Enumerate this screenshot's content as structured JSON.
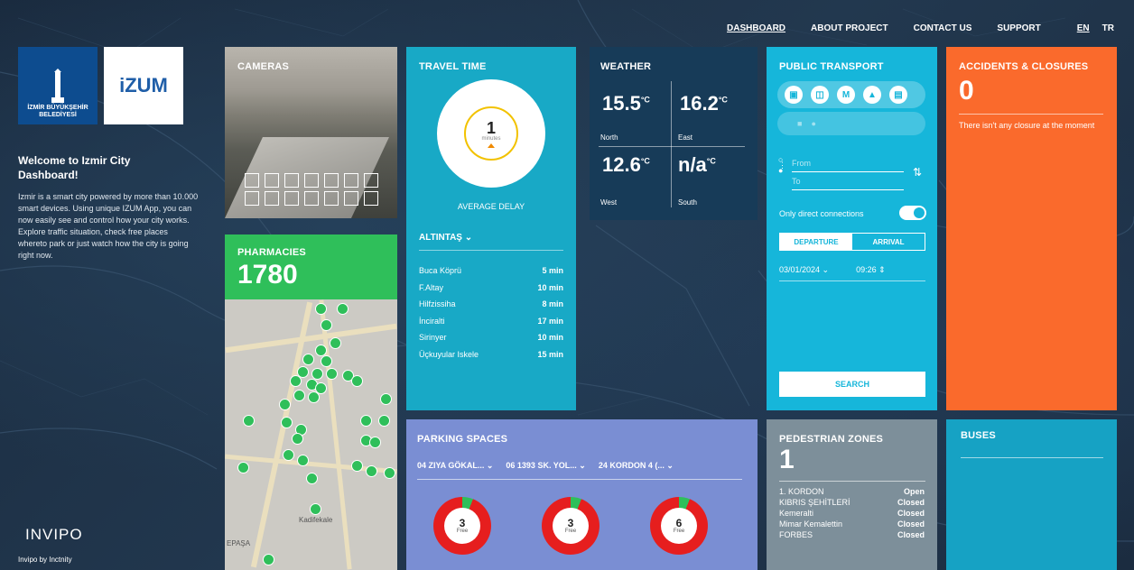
{
  "nav": {
    "items": [
      "DASHBOARD",
      "ABOUT PROJECT",
      "CONTACT US",
      "SUPPORT"
    ],
    "languages": [
      "EN",
      "TR"
    ]
  },
  "welcome": {
    "logo1_text": "İZMİR BÜYÜKŞEHİR BELEDİYESİ",
    "logo2_text": "iZUM",
    "title": "Welcome to Izmir City Dashboard!",
    "text": "Izmir is a smart city powered by more than 10.000 smart devices. Using unique IZUM App, you can now easily see and control how your city works. Explore traffic situation, check free places whereto park or just watch how the city is going right now.",
    "footer_logo": "INVIPO",
    "footer_caption": "Invipo by Inctnity"
  },
  "cameras": {
    "title": "CAMERAS"
  },
  "pharmacies": {
    "title": "PHARMACIES",
    "count": "1780"
  },
  "travel": {
    "title": "TRAVEL TIME",
    "value": "1",
    "unit": "minutes",
    "label": "AVERAGE DELAY",
    "selector": "ALTINTAŞ",
    "rows": [
      {
        "name": "Buca Köprü",
        "value": "5 min"
      },
      {
        "name": "F.Altay",
        "value": "10 min"
      },
      {
        "name": "Hilfzissiha",
        "value": "8 min"
      },
      {
        "name": "İnciralti",
        "value": "17 min"
      },
      {
        "name": "Sirinyer",
        "value": "10 min"
      },
      {
        "name": "Üçkuyular Iskele",
        "value": "15 min"
      }
    ]
  },
  "weather": {
    "title": "WEATHER",
    "north": "15.5",
    "north_label": "North",
    "east": "16.2",
    "east_label": "East",
    "west": "12.6",
    "west_label": "West",
    "south": "n/a",
    "south_label": "South",
    "unit": "°C"
  },
  "transport": {
    "title": "PUBLIC TRANSPORT",
    "from_placeholder": "From",
    "to_placeholder": "To",
    "toggle_label": "Only direct connections",
    "tab_departure": "DEPARTURE",
    "tab_arrival": "ARRIVAL",
    "date": "03/01/2024",
    "time": "09:26",
    "search": "SEARCH"
  },
  "accidents": {
    "title": "ACCIDENTS & CLOSURES",
    "count": "0",
    "text": "There isn't any closure at the moment"
  },
  "parking": {
    "title": "PARKING SPACES",
    "selectors": [
      "04 ZIYA GÖKAL...",
      "06 1393 SK. YOL...",
      "24 KORDON 4 (..."
    ],
    "spaces": [
      {
        "free": "3",
        "label": "Free"
      },
      {
        "free": "3",
        "label": "Free"
      },
      {
        "free": "6",
        "label": "Free"
      }
    ]
  },
  "pedestrian": {
    "title": "PEDESTRIAN ZONES",
    "count": "1",
    "rows": [
      {
        "name": "1. KORDON",
        "status": "Open"
      },
      {
        "name": "KIBRIS ŞEHİTLERİ",
        "status": "Closed"
      },
      {
        "name": "Kemeralti",
        "status": "Closed"
      },
      {
        "name": "Mimar Kemalettin",
        "status": "Closed"
      },
      {
        "name": "FORBES",
        "status": "Closed"
      }
    ]
  },
  "buses": {
    "title": "BUSES"
  },
  "map": {
    "labels": [
      "Kadifekale",
      "EPAŞA"
    ]
  }
}
